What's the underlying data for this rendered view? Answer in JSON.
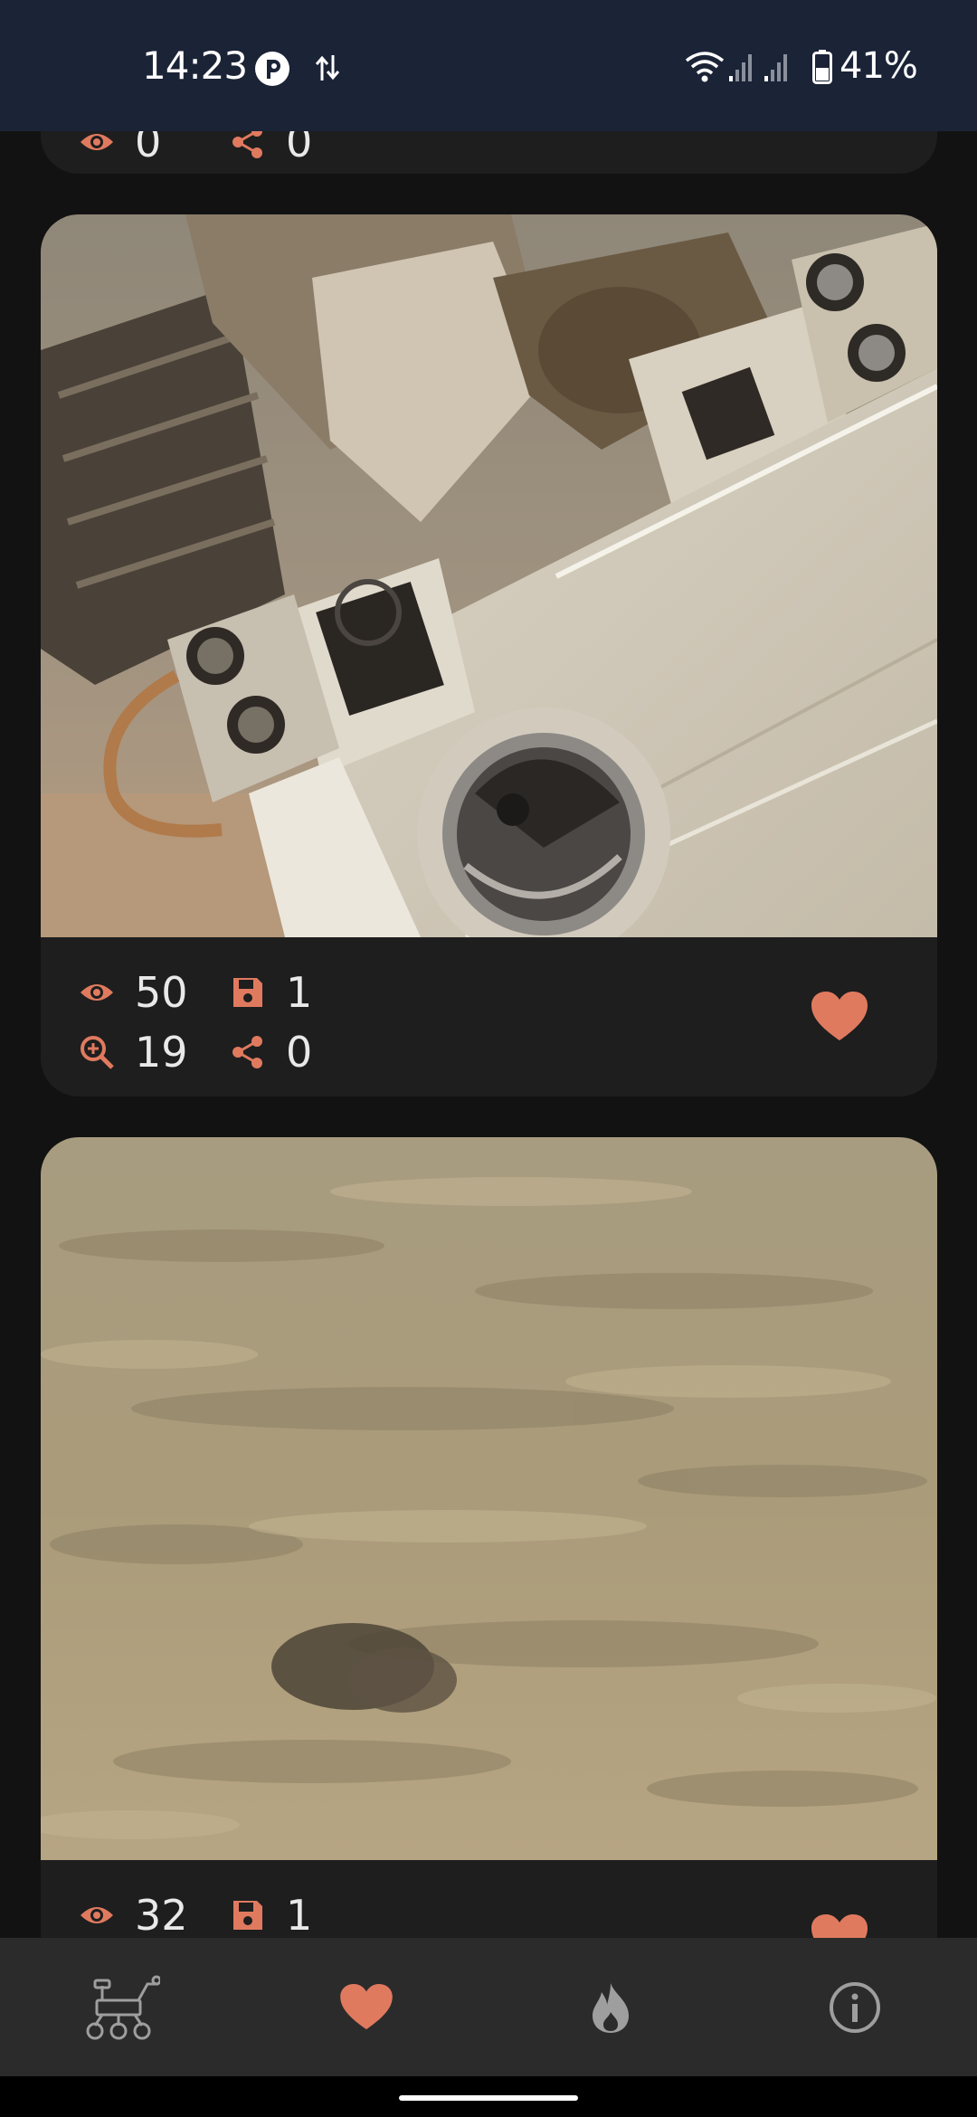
{
  "status_bar": {
    "time": "14:23",
    "battery": "41%",
    "icons": [
      "app-notification-icon",
      "data-transfer-icon",
      "wifi-icon",
      "signal-icon",
      "signal-icon",
      "battery-icon"
    ]
  },
  "colors": {
    "accent": "#E07A5F",
    "status_bar_bg": "#1B2337",
    "card_bg": "#1E1E1E",
    "page_bg": "#121212",
    "nav_bg": "#2B2B2B",
    "nav_icon_inactive": "#9E9E9E"
  },
  "cards": [
    {
      "image": "rover-photo-partial",
      "stats": {
        "views": "0",
        "shares": "0"
      }
    },
    {
      "image": "curiosity-rover-turret-instruments-photo",
      "stats": {
        "views": "50",
        "saves": "1",
        "zooms": "19",
        "shares": "0"
      },
      "favorited": true
    },
    {
      "image": "mars-surface-rocks-photo",
      "stats": {
        "views": "32",
        "saves": "1"
      },
      "favorited": true
    }
  ],
  "stat_icons": {
    "views": "eye-icon",
    "saves": "floppy-disk-icon",
    "zooms": "zoom-in-icon",
    "shares": "share-icon",
    "favorite": "heart-icon"
  },
  "bottom_nav": {
    "items": [
      {
        "icon": "rover-icon",
        "active": false
      },
      {
        "icon": "heart-icon",
        "active": true
      },
      {
        "icon": "flame-icon",
        "active": false
      },
      {
        "icon": "info-icon",
        "active": false
      }
    ]
  }
}
